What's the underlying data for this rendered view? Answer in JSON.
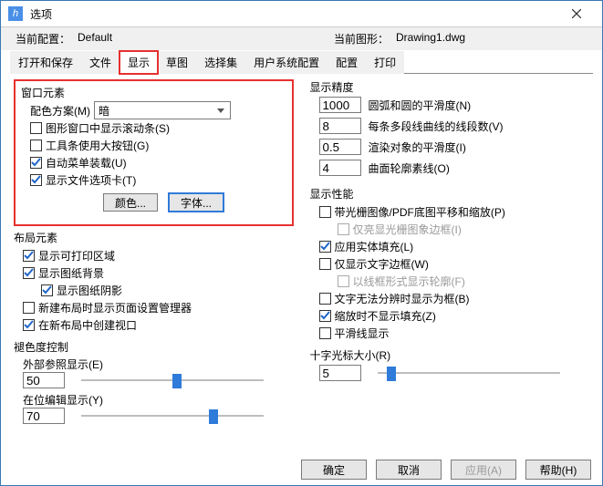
{
  "titlebar": {
    "icon_text": "h",
    "title": "选项"
  },
  "info": {
    "current_config_lbl": "当前配置：",
    "current_config_val": "Default",
    "current_drawing_lbl": "当前图形：",
    "current_drawing_val": "Drawing1.dwg"
  },
  "tabs": {
    "open_save": "打开和保存",
    "file": "文件",
    "display": "显示",
    "draft": "草图",
    "selection": "选择集",
    "user_sys": "用户系统配置",
    "config": "配置",
    "print": "打印"
  },
  "window_elem": {
    "title": "窗口元素",
    "color_scheme_lbl": "配色方案(M)",
    "color_scheme_val": "暗",
    "scrollbars": "图形窗口中显示滚动条(S)",
    "big_buttons": "工具条使用大按钮(G)",
    "auto_menu": "自动菜单装载(U)",
    "file_tabs": "显示文件选项卡(T)",
    "color_btn": "颜色...",
    "font_btn": "字体..."
  },
  "layout_elem": {
    "title": "布局元素",
    "printable": "显示可打印区域",
    "paper_bg": "显示图纸背景",
    "paper_shadow": "显示图纸阴影",
    "new_layout": "新建布局时显示页面设置管理器",
    "viewport": "在新布局中创建视口"
  },
  "fade": {
    "title": "褪色度控制",
    "xref_lbl": "外部参照显示(E)",
    "xref_val": "50",
    "inplace_lbl": "在位编辑显示(Y)",
    "inplace_val": "70"
  },
  "precision": {
    "title": "显示精度",
    "arc_val": "1000",
    "arc_lbl": "圆弧和圆的平滑度(N)",
    "polyline_val": "8",
    "polyline_lbl": "每条多段线曲线的线段数(V)",
    "render_val": "0.5",
    "render_lbl": "渲染对象的平滑度(I)",
    "surface_val": "4",
    "surface_lbl": "曲面轮廓素线(O)"
  },
  "perf": {
    "title": "显示性能",
    "raster": "带光栅图像/PDF底图平移和缩放(P)",
    "highlight": "仅亮显光栅图象边框(I)",
    "solid_fill": "应用实体填充(L)",
    "text_frame": "仅显示文字边框(W)",
    "wireframe": "以线框形式显示轮廓(F)",
    "unresolve": "文字无法分辨时显示为框(B)",
    "zoom_fill": "缩放时不显示填充(Z)",
    "anti_alias": "平滑线显示"
  },
  "crosshair": {
    "title": "十字光标大小(R)",
    "val": "5"
  },
  "footer": {
    "ok": "确定",
    "cancel": "取消",
    "apply": "应用(A)",
    "help": "帮助(H)"
  }
}
